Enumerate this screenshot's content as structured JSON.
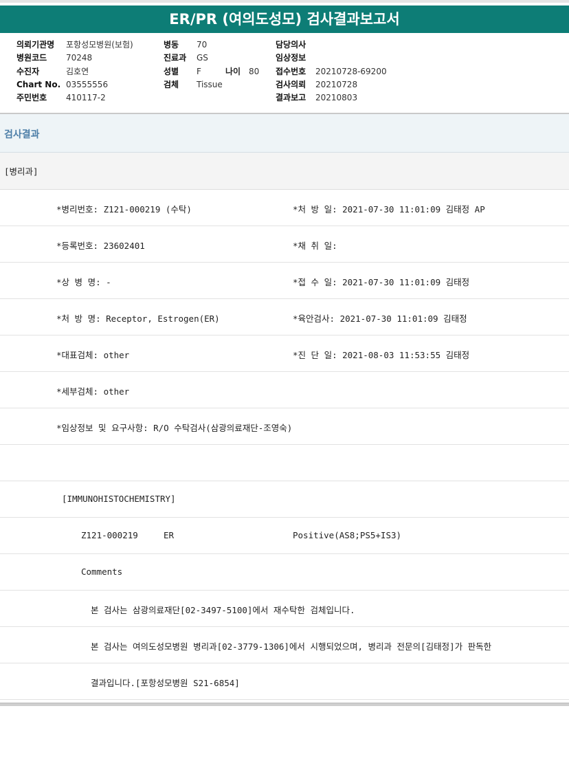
{
  "title": "ER/PR (여의도성모) 검사결과보고서",
  "header": {
    "col1": [
      {
        "label": "의뢰기관명",
        "value": "포항성모병원(보험)"
      },
      {
        "label": "병원코드",
        "value": "70248"
      },
      {
        "label": "수진자",
        "value": "김호연"
      },
      {
        "label": "Chart No.",
        "value": "03555556"
      },
      {
        "label": "주민번호",
        "value": "410117-2"
      }
    ],
    "col2": [
      {
        "label": "병동",
        "value": "70"
      },
      {
        "label": "진료과",
        "value": "GS"
      },
      {
        "label": "성별",
        "value": "F"
      },
      {
        "label": "검체",
        "value": "Tissue"
      }
    ],
    "age_label": "나이",
    "age_value": "80",
    "col3": [
      {
        "label": "담당의사",
        "value": ""
      },
      {
        "label": "임상정보",
        "value": ""
      },
      {
        "label": "접수번호",
        "value": "20210728-69200"
      },
      {
        "label": "검사의뢰",
        "value": "20210728"
      },
      {
        "label": "결과보고",
        "value": "20210803"
      }
    ]
  },
  "section_title": "검사결과",
  "dept": "[병리과]",
  "result": {
    "pathology_no": "*병리번호: Z121-000219 (수탁)",
    "prescribed_date": "*처 방 일: 2021-07-30 11:01:09  김태정 AP",
    "registration_no": "*등록번호: 23602401",
    "collected_date": "*채 취 일:",
    "diagnosis_name": "*상 병 명: -",
    "received_date": "*접 수 일: 2021-07-30 11:01:09  김태정",
    "prescription_name": "*처 방 명: Receptor, Estrogen(ER)",
    "gross_exam": "*육안검사: 2021-07-30 11:01:09  김태정",
    "main_specimen": "*대표검체: other",
    "diagnosis_date": "*진 단 일: 2021-08-03 11:53:55  김태정",
    "sub_specimen": "*세부검체: other",
    "clinical_info": "*임상정보 및 요구사항: R/O 수탁검사(삼광의료재단-조영숙)",
    "ihc_header": "[IMMUNOHISTOCHEMISTRY]",
    "ihc_case": "Z121-000219",
    "ihc_marker": "ER",
    "ihc_result": "Positive(AS8;PS5+IS3)",
    "comments_label": "Comments",
    "comment1": "본 검사는 삼광의료재단[02-3497-5100]에서 재수탁한 검체입니다.",
    "comment2": "본 검사는 여의도성모병원 병리과[02-3779-1306]에서 시행되었으며, 병리과 전문의[김태정]가 판독한",
    "comment3": "결과입니다.[포항성모병원 S21-6854]"
  }
}
